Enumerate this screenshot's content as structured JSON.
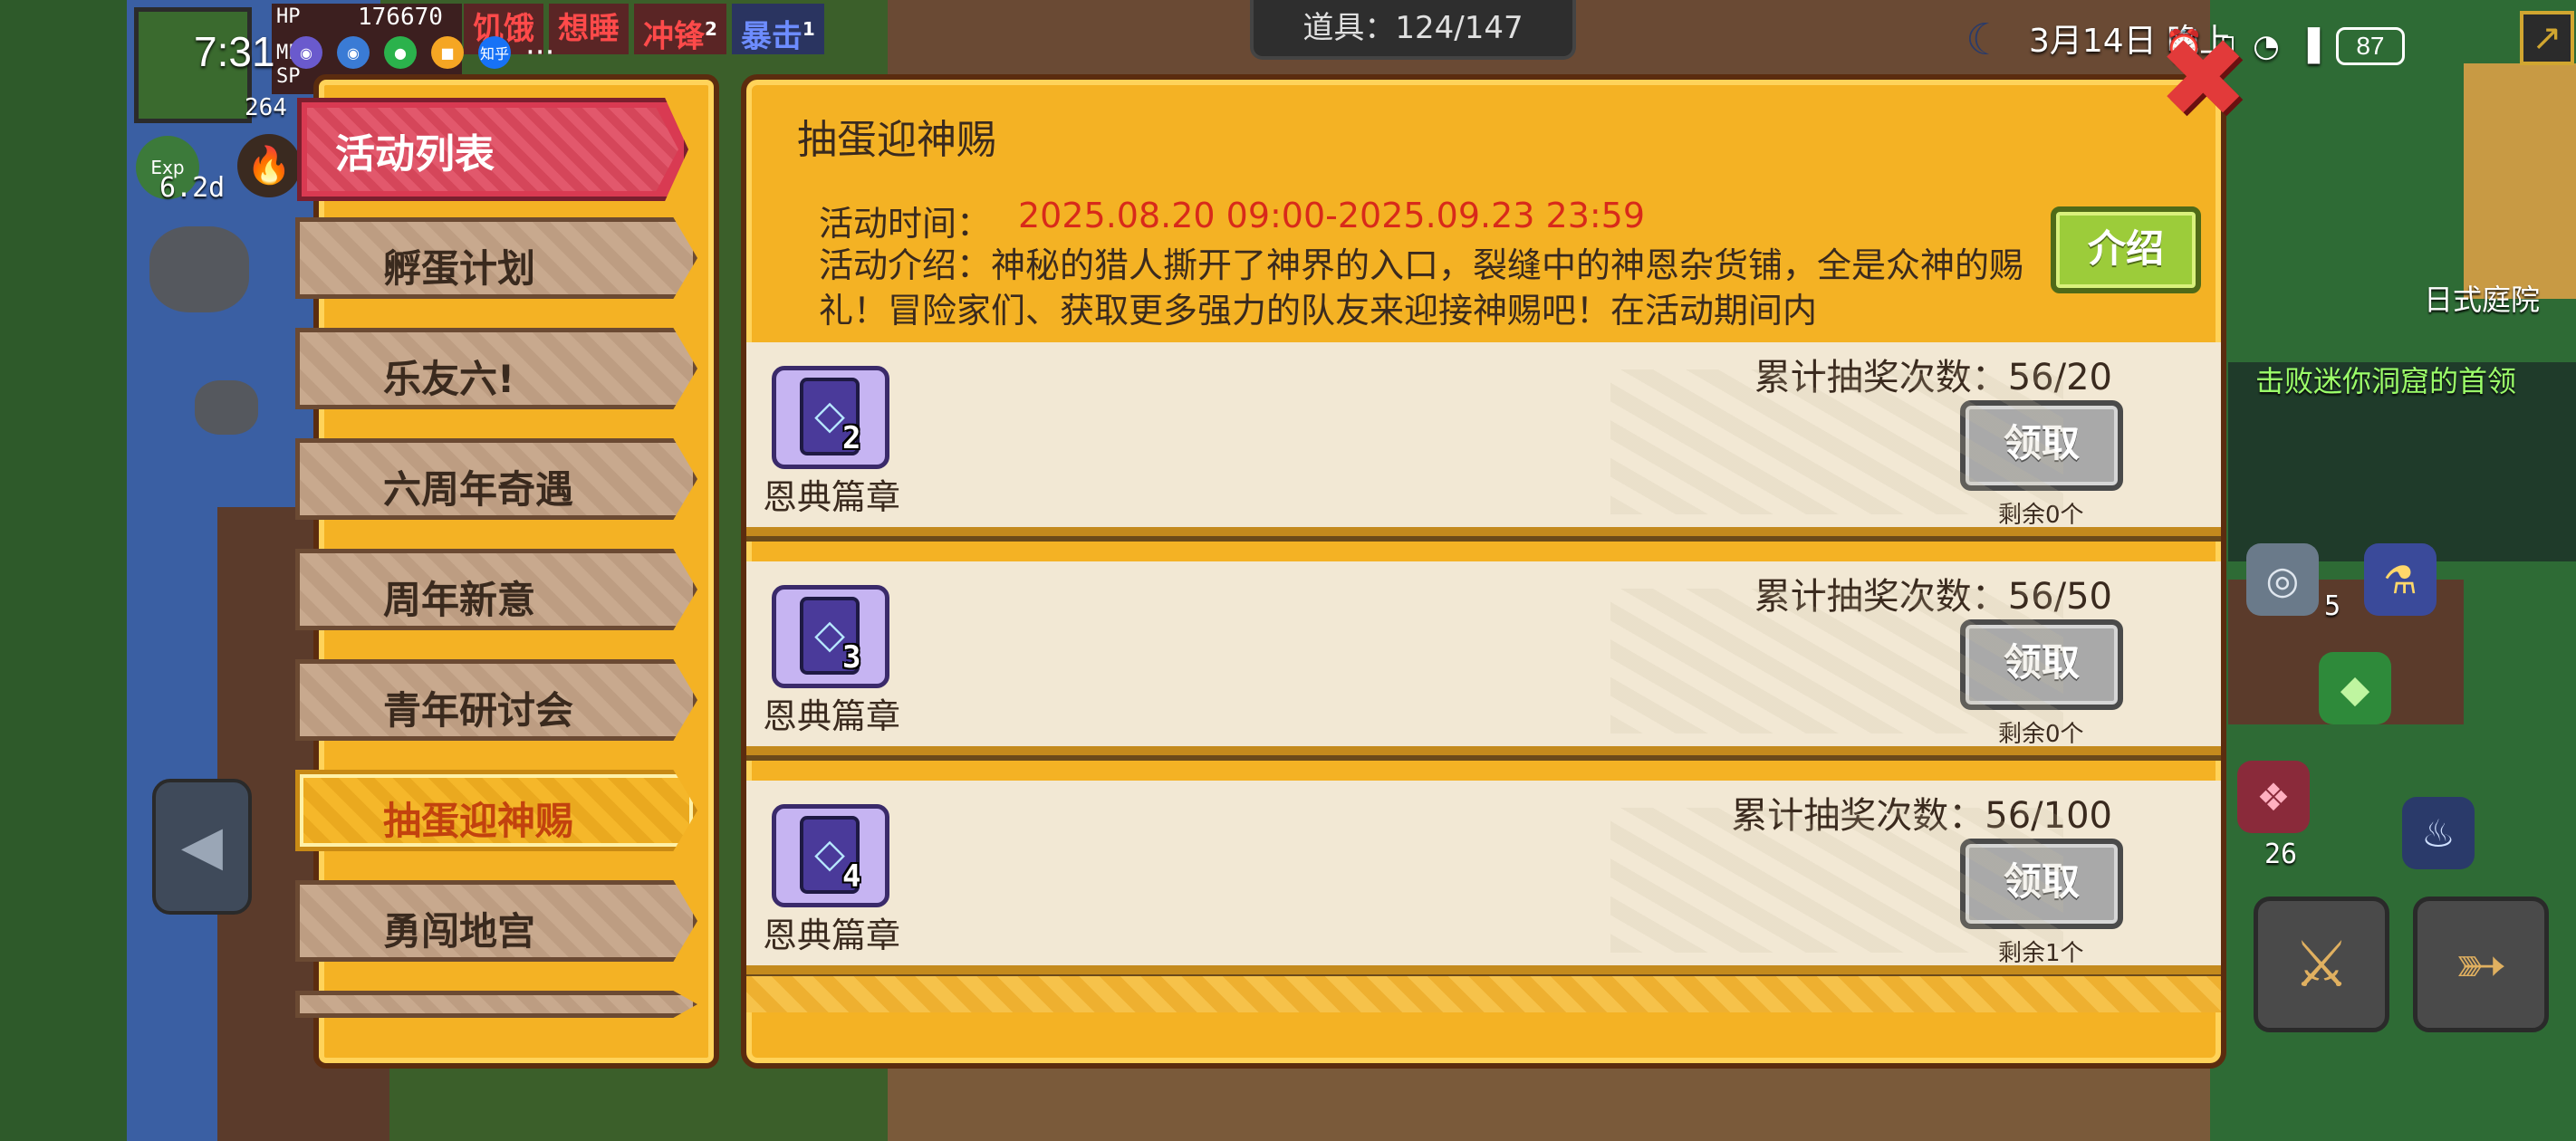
{
  "status_bar": {
    "time": "7:31",
    "battery": "87",
    "app_icons": [
      "app-icon",
      "app-icon",
      "wechat-icon",
      "app-icon",
      "知乎"
    ],
    "more": "···"
  },
  "hud": {
    "hp_label": "HP",
    "hp_value": "176670",
    "mp_label": "MP",
    "sp_label": "SP",
    "level": "264",
    "buffs": [
      {
        "label": "饥饿",
        "sup": ""
      },
      {
        "label": "想睡",
        "sup": ""
      },
      {
        "label": "冲锋",
        "sup": "2"
      },
      {
        "label": "暴击",
        "sup": "1"
      }
    ],
    "exp_label": "Exp",
    "exp_time": "6.2d",
    "items_label": "道具：124/147",
    "date": "3月14日 晚上",
    "map_label": "日式庭院",
    "quest": "击败迷你洞窟的首领",
    "count_5": "5",
    "count_26": "26"
  },
  "activity_list": {
    "header": "活动列表",
    "items": [
      {
        "label": "孵蛋计划",
        "active": false
      },
      {
        "label": "乐友六!",
        "active": false
      },
      {
        "label": "六周年奇遇",
        "active": false
      },
      {
        "label": "周年新意",
        "active": false
      },
      {
        "label": "青年研讨会",
        "active": false
      },
      {
        "label": "抽蛋迎神赐",
        "active": true
      },
      {
        "label": "勇闯地宫",
        "active": false
      }
    ]
  },
  "detail": {
    "title": "抽蛋迎神赐",
    "time_label": "活动时间：",
    "time_value": "2025.08.20 09:00-2025.09.23 23:59",
    "desc": "活动介绍：神秘的猎人撕开了神界的入口，裂缝中的神恩杂货铺，全是众神的赐礼！冒险家们、获取更多强力的队友来迎接神赐吧！在活动期间内",
    "intro_button": "介绍",
    "rewards": [
      {
        "name": "恩典篇章",
        "qty": "2",
        "count": "累计抽奖次数：56/20",
        "claim": "领取",
        "remain": "剩余0个"
      },
      {
        "name": "恩典篇章",
        "qty": "3",
        "count": "累计抽奖次数：56/50",
        "claim": "领取",
        "remain": "剩余0个"
      },
      {
        "name": "恩典篇章",
        "qty": "4",
        "count": "累计抽奖次数：56/100",
        "claim": "领取",
        "remain": "剩余1个"
      }
    ]
  },
  "icons": {
    "close": "close-icon",
    "reward": "card-icon",
    "moon": "moon-icon"
  },
  "colors": {
    "panel": "#f4b224",
    "header_red": "#d93a52",
    "time_red": "#d82a1a",
    "intro_green": "#9ccc3a",
    "claim_gray": "#a9a9a9"
  }
}
